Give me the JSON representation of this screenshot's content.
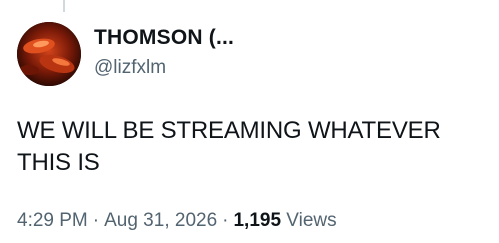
{
  "author": {
    "display_name": "THOMSON (...",
    "handle": "@lizfxlm",
    "avatar_icon": "avatar-photo"
  },
  "tweet": {
    "text": "WE WILL BE STREAMING WHATEVER THIS IS"
  },
  "meta": {
    "time": "4:29 PM",
    "separator": "·",
    "date": "Aug 31, 2026",
    "views_count": "1,195",
    "views_label": "Views"
  },
  "colors": {
    "primary_text": "#0f1419",
    "secondary_text": "#536471",
    "thread_line": "#cfd9de"
  }
}
